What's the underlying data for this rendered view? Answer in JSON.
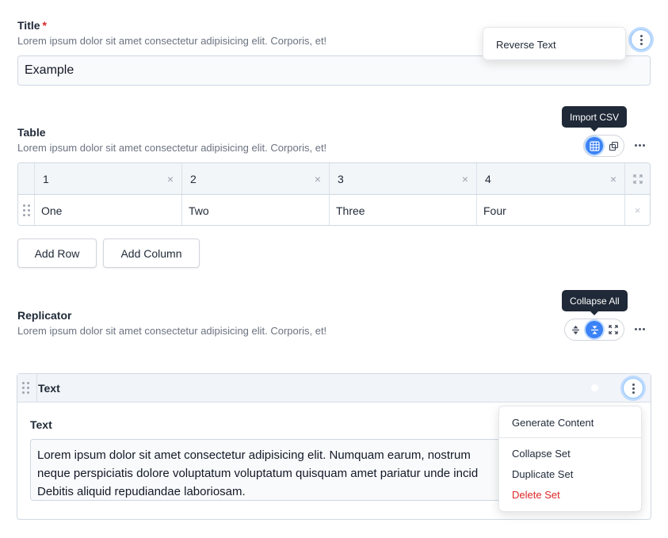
{
  "title_field": {
    "label": "Title",
    "required_mark": "*",
    "description": "Lorem ipsum dolor sit amet consectetur adipisicing elit. Corporis, et!",
    "value": "Example",
    "menu": {
      "items": [
        "Reverse Text"
      ]
    }
  },
  "table_field": {
    "label": "Table",
    "description": "Lorem ipsum dolor sit amet consectetur adipisicing elit. Corporis, et!",
    "tooltip": "Import CSV",
    "columns": [
      "1",
      "2",
      "3",
      "4"
    ],
    "rows": [
      [
        "One",
        "Two",
        "Three",
        "Four"
      ]
    ],
    "remove_glyph": "×",
    "add_row_label": "Add Row",
    "add_column_label": "Add Column"
  },
  "replicator_field": {
    "label": "Replicator",
    "description": "Lorem ipsum dolor sit amet consectetur adipisicing elit. Corporis, et!",
    "tooltip": "Collapse All",
    "set": {
      "title": "Text",
      "enabled": true,
      "field_label": "Text",
      "lines": [
        "Lorem ipsum dolor sit amet consectetur adipisicing elit. Numquam earum, nostrum",
        "neque perspiciatis dolore voluptatum voluptatum quisquam amet pariatur unde incid",
        "Debitis aliquid repudiandae laboriosam."
      ],
      "menu": {
        "primary": "Generate Content",
        "items": [
          "Collapse Set",
          "Duplicate Set"
        ],
        "danger": "Delete Set"
      }
    }
  },
  "colors": {
    "accent": "#3b82f6",
    "danger": "#dc2626",
    "toggle_on": "#22c55e"
  }
}
